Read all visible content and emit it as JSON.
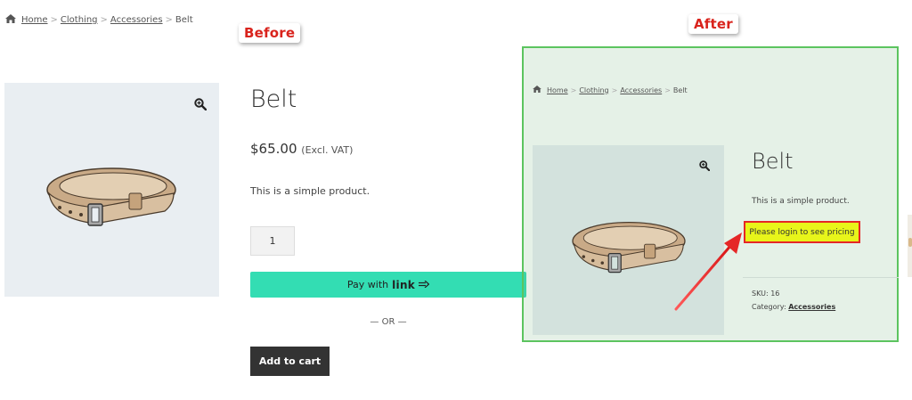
{
  "before": {
    "stamp": "Before",
    "breadcrumb": {
      "items": [
        "Home",
        "Clothing",
        "Accessories"
      ],
      "current": "Belt",
      "separator": ">"
    },
    "product": {
      "title": "Belt",
      "price": "$65.00",
      "tax_note": "(Excl. VAT)",
      "description": "This is a simple product.",
      "quantity": "1",
      "pay_label": "Pay with",
      "pay_brand": "link",
      "or_text": "— OR —",
      "add_to_cart": "Add to cart"
    }
  },
  "after": {
    "stamp": "After",
    "breadcrumb": {
      "items": [
        "Home",
        "Clothing",
        "Accessories"
      ],
      "current": "Belt",
      "separator": ">"
    },
    "product": {
      "title": "Belt",
      "description": "This is a simple product.",
      "login_notice": "Please login to see pricing",
      "sku_label": "SKU:",
      "sku_value": "16",
      "category_label": "Category:",
      "category_value": "Accessories"
    }
  },
  "colors": {
    "pay_button": "#33ddb3",
    "cart_button": "#333333",
    "stamp_text": "#d9231c",
    "after_border": "#5cc45f",
    "login_highlight": "#e8f51a",
    "login_border": "#e52727",
    "arrow": "#e52727"
  },
  "icons": [
    "home-icon",
    "zoom-icon",
    "arrow-right-icon",
    "annotation-arrow-icon"
  ]
}
